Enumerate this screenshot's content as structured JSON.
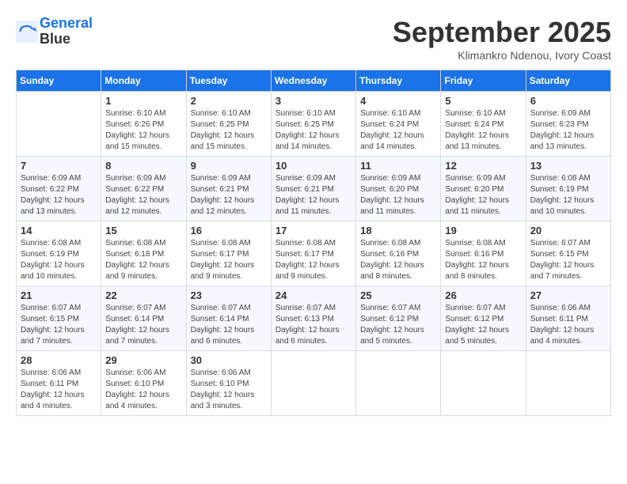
{
  "header": {
    "logo_line1": "General",
    "logo_line2": "Blue",
    "month": "September 2025",
    "location": "Klimankro Ndenou, Ivory Coast"
  },
  "days_of_week": [
    "Sunday",
    "Monday",
    "Tuesday",
    "Wednesday",
    "Thursday",
    "Friday",
    "Saturday"
  ],
  "weeks": [
    [
      {
        "num": "",
        "empty": true
      },
      {
        "num": "1",
        "rise": "6:10 AM",
        "set": "6:26 PM",
        "daylight": "12 hours and 15 minutes."
      },
      {
        "num": "2",
        "rise": "6:10 AM",
        "set": "6:25 PM",
        "daylight": "12 hours and 15 minutes."
      },
      {
        "num": "3",
        "rise": "6:10 AM",
        "set": "6:25 PM",
        "daylight": "12 hours and 14 minutes."
      },
      {
        "num": "4",
        "rise": "6:10 AM",
        "set": "6:24 PM",
        "daylight": "12 hours and 14 minutes."
      },
      {
        "num": "5",
        "rise": "6:10 AM",
        "set": "6:24 PM",
        "daylight": "12 hours and 13 minutes."
      },
      {
        "num": "6",
        "rise": "6:09 AM",
        "set": "6:23 PM",
        "daylight": "12 hours and 13 minutes."
      }
    ],
    [
      {
        "num": "7",
        "rise": "6:09 AM",
        "set": "6:22 PM",
        "daylight": "12 hours and 13 minutes."
      },
      {
        "num": "8",
        "rise": "6:09 AM",
        "set": "6:22 PM",
        "daylight": "12 hours and 12 minutes."
      },
      {
        "num": "9",
        "rise": "6:09 AM",
        "set": "6:21 PM",
        "daylight": "12 hours and 12 minutes."
      },
      {
        "num": "10",
        "rise": "6:09 AM",
        "set": "6:21 PM",
        "daylight": "12 hours and 11 minutes."
      },
      {
        "num": "11",
        "rise": "6:09 AM",
        "set": "6:20 PM",
        "daylight": "12 hours and 11 minutes."
      },
      {
        "num": "12",
        "rise": "6:09 AM",
        "set": "6:20 PM",
        "daylight": "12 hours and 11 minutes."
      },
      {
        "num": "13",
        "rise": "6:08 AM",
        "set": "6:19 PM",
        "daylight": "12 hours and 10 minutes."
      }
    ],
    [
      {
        "num": "14",
        "rise": "6:08 AM",
        "set": "6:19 PM",
        "daylight": "12 hours and 10 minutes."
      },
      {
        "num": "15",
        "rise": "6:08 AM",
        "set": "6:18 PM",
        "daylight": "12 hours and 9 minutes."
      },
      {
        "num": "16",
        "rise": "6:08 AM",
        "set": "6:17 PM",
        "daylight": "12 hours and 9 minutes."
      },
      {
        "num": "17",
        "rise": "6:08 AM",
        "set": "6:17 PM",
        "daylight": "12 hours and 9 minutes."
      },
      {
        "num": "18",
        "rise": "6:08 AM",
        "set": "6:16 PM",
        "daylight": "12 hours and 8 minutes."
      },
      {
        "num": "19",
        "rise": "6:08 AM",
        "set": "6:16 PM",
        "daylight": "12 hours and 8 minutes."
      },
      {
        "num": "20",
        "rise": "6:07 AM",
        "set": "6:15 PM",
        "daylight": "12 hours and 7 minutes."
      }
    ],
    [
      {
        "num": "21",
        "rise": "6:07 AM",
        "set": "6:15 PM",
        "daylight": "12 hours and 7 minutes."
      },
      {
        "num": "22",
        "rise": "6:07 AM",
        "set": "6:14 PM",
        "daylight": "12 hours and 7 minutes."
      },
      {
        "num": "23",
        "rise": "6:07 AM",
        "set": "6:14 PM",
        "daylight": "12 hours and 6 minutes."
      },
      {
        "num": "24",
        "rise": "6:07 AM",
        "set": "6:13 PM",
        "daylight": "12 hours and 6 minutes."
      },
      {
        "num": "25",
        "rise": "6:07 AM",
        "set": "6:12 PM",
        "daylight": "12 hours and 5 minutes."
      },
      {
        "num": "26",
        "rise": "6:07 AM",
        "set": "6:12 PM",
        "daylight": "12 hours and 5 minutes."
      },
      {
        "num": "27",
        "rise": "6:06 AM",
        "set": "6:11 PM",
        "daylight": "12 hours and 4 minutes."
      }
    ],
    [
      {
        "num": "28",
        "rise": "6:06 AM",
        "set": "6:11 PM",
        "daylight": "12 hours and 4 minutes."
      },
      {
        "num": "29",
        "rise": "6:06 AM",
        "set": "6:10 PM",
        "daylight": "12 hours and 4 minutes."
      },
      {
        "num": "30",
        "rise": "6:06 AM",
        "set": "6:10 PM",
        "daylight": "12 hours and 3 minutes."
      },
      {
        "num": "",
        "empty": true
      },
      {
        "num": "",
        "empty": true
      },
      {
        "num": "",
        "empty": true
      },
      {
        "num": "",
        "empty": true
      }
    ]
  ]
}
